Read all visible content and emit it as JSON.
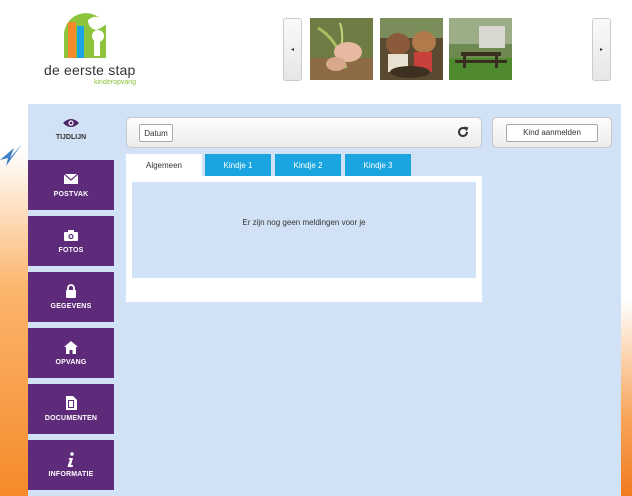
{
  "header": {
    "logo_text": "de eerste stap",
    "logo_subtext": "kinderopvang",
    "carousel_prev": "◂",
    "carousel_next": "▸"
  },
  "sidebar": {
    "active": {
      "label": "TIJDLIJN",
      "icon": "eye-icon"
    },
    "items": [
      {
        "label": "POSTVAK",
        "icon": "envelope-icon"
      },
      {
        "label": "FOTOS",
        "icon": "camera-icon"
      },
      {
        "label": "GEGEVENS",
        "icon": "lock-icon"
      },
      {
        "label": "OPVANG",
        "icon": "home-icon"
      },
      {
        "label": "DOCUMENTEN",
        "icon": "document-icon"
      },
      {
        "label": "INFORMATIE",
        "icon": "info-icon"
      }
    ]
  },
  "toolbar": {
    "datum_label": "Datum",
    "refresh_icon": "refresh-icon",
    "kind_button": "Kind aanmelden"
  },
  "tabs": [
    {
      "label": "Algemeen",
      "active": true
    },
    {
      "label": "Kindje 1",
      "active": false
    },
    {
      "label": "Kindje 2",
      "active": false
    },
    {
      "label": "Kindje 3",
      "active": false
    }
  ],
  "content": {
    "message": "Er zijn nog geen meldingen voor je"
  },
  "colors": {
    "sidebar_purple": "#5e2a7a",
    "panel_blue": "#d2e2f6",
    "tab_blue": "#1aa5e0",
    "accent_orange": "#f58a2a",
    "logo_green": "#8cc43c"
  }
}
